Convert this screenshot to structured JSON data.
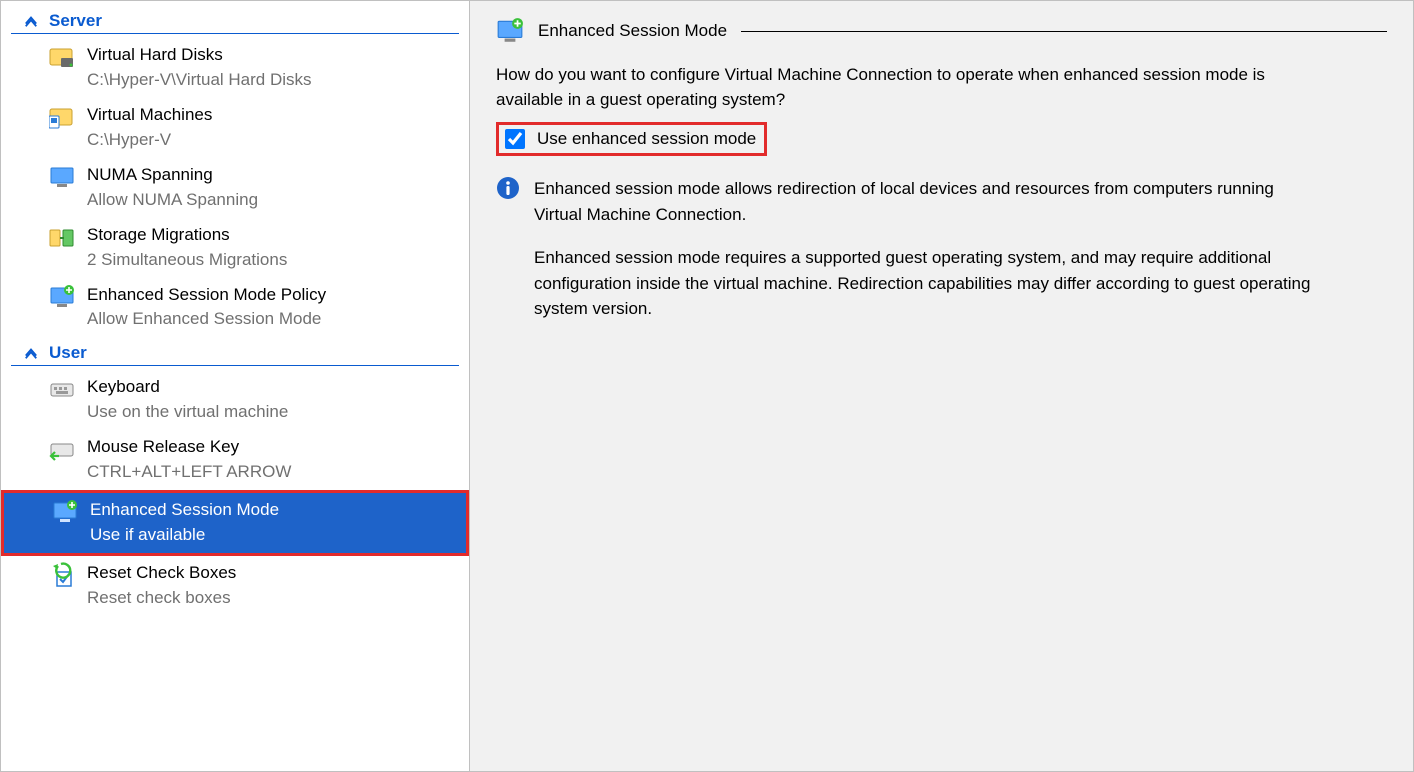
{
  "sidebar": {
    "sections": [
      {
        "title": "Server",
        "items": [
          {
            "label": "Virtual Hard Disks",
            "sub": "C:\\Hyper-V\\Virtual Hard Disks"
          },
          {
            "label": "Virtual Machines",
            "sub": "C:\\Hyper-V"
          },
          {
            "label": "NUMA Spanning",
            "sub": "Allow NUMA Spanning"
          },
          {
            "label": "Storage Migrations",
            "sub": "2 Simultaneous Migrations"
          },
          {
            "label": "Enhanced Session Mode Policy",
            "sub": "Allow Enhanced Session Mode"
          }
        ]
      },
      {
        "title": "User",
        "items": [
          {
            "label": "Keyboard",
            "sub": "Use on the virtual machine"
          },
          {
            "label": "Mouse Release Key",
            "sub": "CTRL+ALT+LEFT ARROW"
          },
          {
            "label": "Enhanced Session Mode",
            "sub": "Use if available",
            "selected": true
          },
          {
            "label": "Reset Check Boxes",
            "sub": "Reset check boxes"
          }
        ]
      }
    ]
  },
  "content": {
    "title": "Enhanced Session Mode",
    "description": "How do you want to configure Virtual Machine Connection to operate when enhanced session mode is available in a guest operating system?",
    "checkbox_label": "Use enhanced session mode",
    "checkbox_checked": true,
    "info_p1": "Enhanced session mode allows redirection of local devices and resources from computers running Virtual Machine Connection.",
    "info_p2": "Enhanced session mode requires a supported guest operating system, and may require additional configuration inside the virtual machine. Redirection capabilities may differ according to guest operating system version."
  }
}
